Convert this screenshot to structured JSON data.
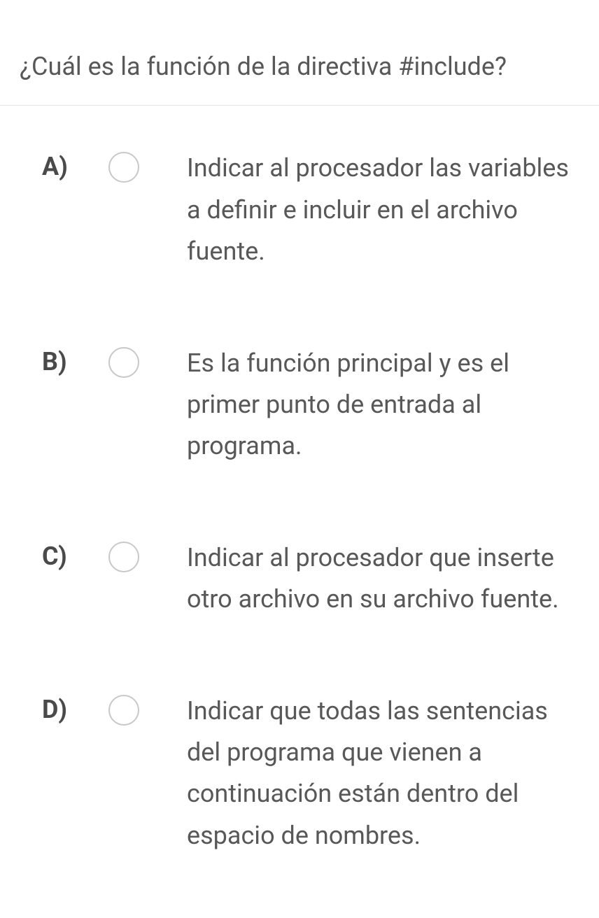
{
  "question": {
    "text": "¿Cuál es la función de la directiva #include?"
  },
  "options": [
    {
      "label": "A)",
      "text": "Indicar al procesador las variables a definir e incluir en el archivo fuente."
    },
    {
      "label": "B)",
      "text": "Es la función principal y es el primer punto de entrada al programa."
    },
    {
      "label": "C)",
      "text": "Indicar al procesador que inserte otro archivo en su archivo fuente."
    },
    {
      "label": "D)",
      "text": "Indicar que todas las sentencias del programa que vienen a continuación están dentro del espacio de nombres."
    }
  ]
}
